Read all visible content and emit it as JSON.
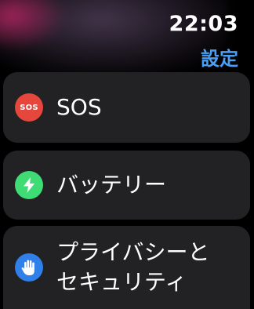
{
  "status": {
    "time": "22:03"
  },
  "nav": {
    "back_label": "設定"
  },
  "menu": {
    "items": [
      {
        "label": "SOS",
        "icon": "sos-icon",
        "icon_text": "SOS",
        "icon_color": "#e5473d"
      },
      {
        "label": "バッテリー",
        "icon": "battery-bolt-icon",
        "icon_color": "#3fdc75"
      },
      {
        "label_line1": "プライバシーと",
        "label_line2": "セキュリティ",
        "icon": "raised-hand-icon",
        "icon_color": "#2f80e8"
      }
    ]
  },
  "colors": {
    "accent": "#4a9ff5",
    "row_background": "#222224",
    "background": "#000000"
  }
}
